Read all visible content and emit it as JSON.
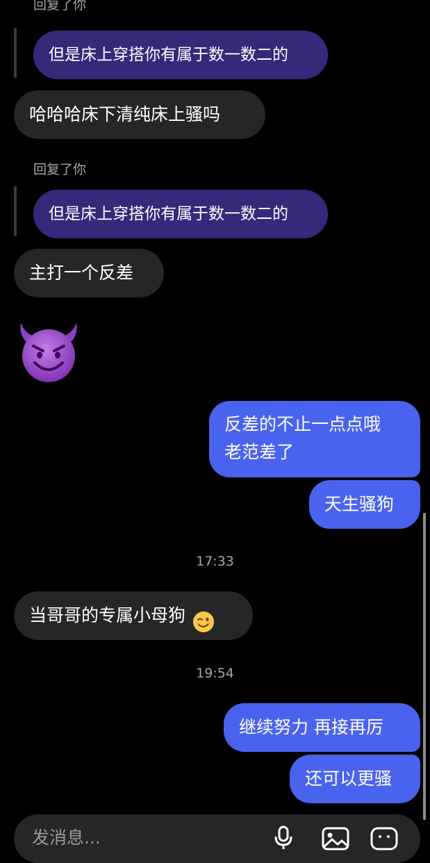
{
  "messages": [
    {
      "kind": "reply_label",
      "text": "回复了你"
    },
    {
      "kind": "quoted",
      "text": "但是床上穿搭你有属于数一数二的"
    },
    {
      "kind": "incoming",
      "text": "哈哈哈床下清纯床上骚吗"
    },
    {
      "kind": "reply_label",
      "text": "回复了你"
    },
    {
      "kind": "quoted",
      "text": "但是床上穿搭你有属于数一数二的"
    },
    {
      "kind": "incoming",
      "text": "主打一个反差"
    },
    {
      "kind": "emoji",
      "icon": "smiling-face-with-horns-icon"
    },
    {
      "kind": "outgoing",
      "lines": [
        "反差的不止一点点哦",
        "老范差了"
      ]
    },
    {
      "kind": "outgoing",
      "text": "天生骚狗"
    },
    {
      "kind": "timestamp",
      "text": "17:33"
    },
    {
      "kind": "incoming",
      "text": "当哥哥的专属小母狗",
      "trailing_icon": "winking-face-icon"
    },
    {
      "kind": "timestamp",
      "text": "19:54"
    },
    {
      "kind": "outgoing",
      "text": "继续努力 再接再厉"
    },
    {
      "kind": "outgoing",
      "text": "还可以更骚"
    }
  ],
  "composer": {
    "placeholder": "发消息...",
    "icons": [
      "microphone-icon",
      "image-icon",
      "sticker-icon"
    ]
  },
  "colors": {
    "background": "#000000",
    "incoming_bubble": "#262626",
    "outgoing_bubble": "#4a63ee",
    "quoted_bubble": "#38287a",
    "meta_text": "#a8a8a8"
  }
}
